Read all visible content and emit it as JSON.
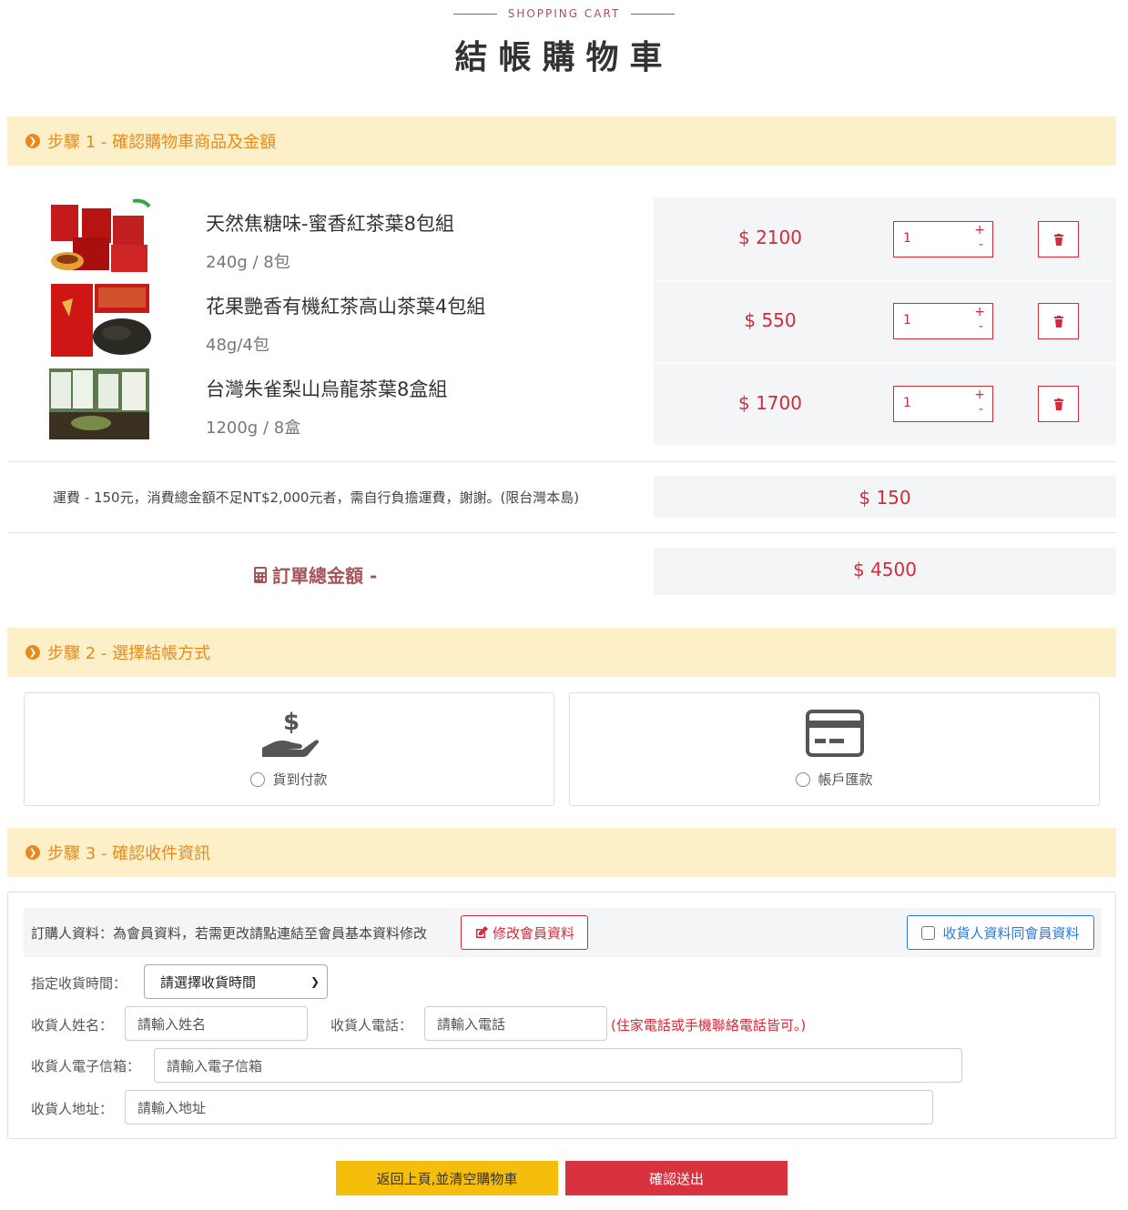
{
  "header": {
    "eyebrow": "SHOPPING CART",
    "title": "結帳購物車"
  },
  "steps": {
    "step1": "步驟 1 - 確認購物車商品及金額",
    "step2": "步驟 2 - 選擇結帳方式",
    "step3": "步驟 3 - 確認收件資訊"
  },
  "cart": {
    "items": [
      {
        "name": "天然焦糖味-蜜香紅茶葉8包組",
        "spec": "240g / 8包",
        "price": "$ 2100",
        "qty": "1"
      },
      {
        "name": "花果艷香有機紅茶高山茶葉4包組",
        "spec": "48g/4包",
        "price": "$ 550",
        "qty": "1"
      },
      {
        "name": "台灣朱雀梨山烏龍茶葉8盒組",
        "spec": "1200g / 8盒",
        "price": "$ 1700",
        "qty": "1"
      }
    ],
    "shipping_note": "運費 - 150元，消費總金額不足NT$2,000元者，需自行負擔運費，謝謝。(限台灣本島)",
    "shipping_price": "$ 150",
    "total_label": "訂單總金額 -",
    "total_price": "$ 4500"
  },
  "payment": {
    "cod_label": "貨到付款",
    "transfer_label": "帳戶匯款"
  },
  "recipient": {
    "member_note": "訂購人資料：為會員資料，若需更改請點連結至會員基本資料修改",
    "edit_member_label": "修改會員資料",
    "same_as_member_label": "收貨人資料同會員資料",
    "time_label": "指定收貨時間：",
    "time_selected": "請選擇收貨時間",
    "name_label": "收貨人姓名：",
    "name_placeholder": "請輸入姓名",
    "phone_label": "收貨人電話：",
    "phone_placeholder": "請輸入電話",
    "phone_note": "(住家電話或手機聯絡電話皆可。)",
    "email_label": "收貨人電子信箱：",
    "email_placeholder": "請輸入電子信箱",
    "address_label": "收貨人地址：",
    "address_placeholder": "請輸入地址"
  },
  "actions": {
    "back_label": "返回上頁,並清空購物車",
    "submit_label": "確認送出"
  },
  "colors": {
    "accent_red": "#d42a3a",
    "step_orange": "#e58b1d",
    "step_bg": "#fdefc8",
    "back_yellow": "#f5be0b",
    "submit_red": "#d8323f",
    "link_blue": "#2b7cd6"
  }
}
